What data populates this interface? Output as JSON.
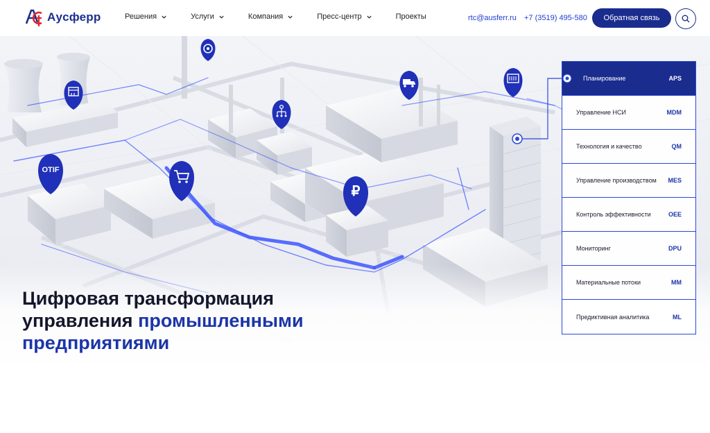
{
  "brand": {
    "name": "Ауcферр"
  },
  "nav": [
    {
      "label": "Решения",
      "dropdown": true
    },
    {
      "label": "Услуги",
      "dropdown": true
    },
    {
      "label": "Компания",
      "dropdown": true
    },
    {
      "label": "Пресс-центр",
      "dropdown": true
    },
    {
      "label": "Проекты",
      "dropdown": false
    }
  ],
  "contacts": {
    "email": "rtc@ausferr.ru",
    "phone": "+7 (3519) 495-580"
  },
  "feedback_label": "Обратная связь",
  "headline": {
    "line1": "Цифровая трансформация",
    "line2_plain": "управления ",
    "line2_accent": "промышленными",
    "line3_accent": "предприятиями"
  },
  "modules": [
    {
      "label": "Планирование",
      "code": "APS",
      "active": true
    },
    {
      "label": "Управление НСИ",
      "code": "MDM"
    },
    {
      "label": "Технология и качество",
      "code": "QM"
    },
    {
      "label": "Управление производством",
      "code": "MES"
    },
    {
      "label": "Контроль эффективности",
      "code": "OEE"
    },
    {
      "label": "Мониторинг",
      "code": "DPU"
    },
    {
      "label": "Материальные потоки",
      "code": "MM"
    },
    {
      "label": "Предиктивная аналитика",
      "code": "ML"
    }
  ],
  "map_pins": [
    {
      "icon": "gear-icon"
    },
    {
      "icon": "calendar-icon"
    },
    {
      "icon": "workflow-icon"
    },
    {
      "icon": "truck-icon"
    },
    {
      "icon": "server-icon"
    },
    {
      "label": "OTIF",
      "icon": "otif-label"
    },
    {
      "icon": "cart-icon"
    },
    {
      "icon": "ruble-icon"
    }
  ],
  "colors": {
    "brand": "#1a2c8e",
    "accent": "#1c35a8",
    "link": "#1e3fd0",
    "route": "#3d55ff"
  }
}
